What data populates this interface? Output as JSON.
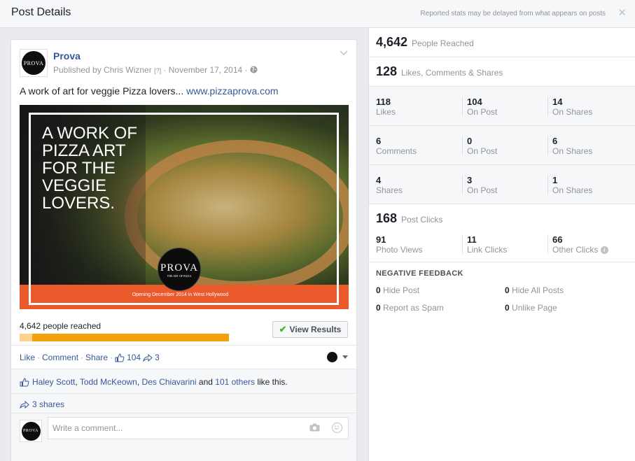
{
  "header": {
    "title": "Post Details",
    "note": "Reported stats may be delayed from what appears on posts",
    "close": "✕"
  },
  "post": {
    "page_name": "Prova",
    "logo_text": "PROVA",
    "publisher": "Published by Chris Wizner",
    "help_mark": "[?]",
    "date": "November 17, 2014",
    "text": "A work of art for veggie Pizza lovers...",
    "url": "www.pizzaprova.com",
    "image": {
      "headline": "A WORK OF\nPIZZA ART\nFOR THE\nVEGGIE\nLOVERS.",
      "logo": "PROVA",
      "logo_sub": "THE ART OF PIZZA",
      "tagline": "Opening December 2014 in West Hollywood"
    },
    "reached_text": "4,642 people reached",
    "reach_paid_fraction": 0.06,
    "view_results": "View Results",
    "actions": {
      "like": "Like",
      "comment": "Comment",
      "share": "Share",
      "like_count": "104",
      "share_count": "3"
    },
    "likers": {
      "name1": "Haley Scott",
      "name2": "Todd McKeown",
      "name3": "Des Chiavarini",
      "and": "and",
      "others": "101 others",
      "suffix": "like this."
    },
    "shares_text": "3 shares",
    "comment_placeholder": "Write a comment..."
  },
  "stats": {
    "reached": {
      "num": "4,642",
      "label": "People Reached"
    },
    "engagement": {
      "num": "128",
      "label": "Likes, Comments & Shares"
    },
    "likes": [
      {
        "v": "118",
        "l": "Likes"
      },
      {
        "v": "104",
        "l": "On Post"
      },
      {
        "v": "14",
        "l": "On Shares"
      }
    ],
    "comments": [
      {
        "v": "6",
        "l": "Comments"
      },
      {
        "v": "0",
        "l": "On Post"
      },
      {
        "v": "6",
        "l": "On Shares"
      }
    ],
    "shares": [
      {
        "v": "4",
        "l": "Shares"
      },
      {
        "v": "3",
        "l": "On Post"
      },
      {
        "v": "1",
        "l": "On Shares"
      }
    ],
    "clicks": {
      "num": "168",
      "label": "Post Clicks"
    },
    "click_breakdown": [
      {
        "v": "91",
        "l": "Photo Views"
      },
      {
        "v": "11",
        "l": "Link Clicks"
      },
      {
        "v": "66",
        "l": "Other Clicks"
      }
    ],
    "negative": {
      "title": "NEGATIVE FEEDBACK",
      "hide_post": {
        "v": "0",
        "l": "Hide Post"
      },
      "hide_all": {
        "v": "0",
        "l": "Hide All Posts"
      },
      "spam": {
        "v": "0",
        "l": "Report as Spam"
      },
      "unlike": {
        "v": "0",
        "l": "Unlike Page"
      }
    }
  }
}
